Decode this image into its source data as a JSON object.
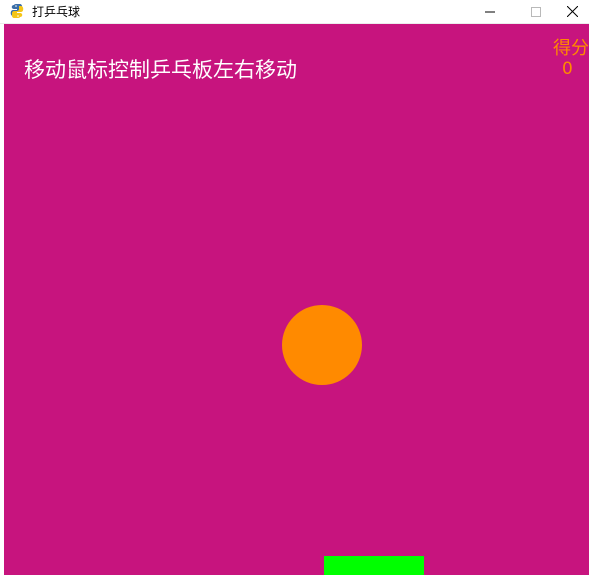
{
  "window": {
    "title": "打乒乓球",
    "app_icon": "snake-icon",
    "controls": [
      "minimize-icon",
      "maximize-icon",
      "close-icon"
    ]
  },
  "game": {
    "instruction": "移动鼠标控制乒乓板左右移动",
    "score_label": "得分",
    "score_value": "0",
    "colors": {
      "background": "#c7147e",
      "ball": "#ff8a00",
      "paddle": "#00ff00",
      "score_text": "#ff8a00",
      "instruction_text": "#ffffff"
    }
  }
}
